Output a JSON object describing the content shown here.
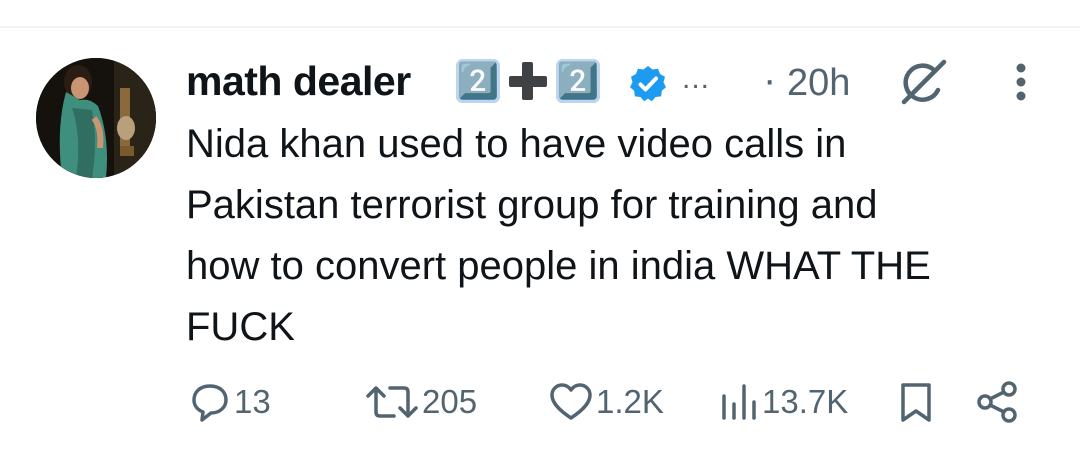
{
  "tweet": {
    "author": {
      "display_name": "math dealer",
      "name_emoji": [
        "2️⃣",
        "➕",
        "2️⃣"
      ],
      "verified": true,
      "avatar_icon": "profile-photo"
    },
    "truncation": "...",
    "time_separator": "·",
    "timestamp": "20h",
    "text": "Nida khan used to have video calls in\nPakistan terrorist group for training and\nhow to convert people in india WHAT THE\nFUCK",
    "metrics": {
      "replies": "13",
      "reposts": "205",
      "likes": "1.2K",
      "views": "13.7K"
    }
  },
  "icons": {
    "verified": "verified-badge-icon",
    "grok": "grok-icon",
    "more": "more-options-icon",
    "reply": "reply-icon",
    "repost": "repost-icon",
    "like": "like-icon",
    "views": "views-icon",
    "bookmark": "bookmark-icon",
    "share": "share-icon"
  },
  "colors": {
    "text": "#0f1419",
    "secondary": "#536471",
    "verified": "#1d9bf0",
    "divider": "#eff3f4",
    "background": "#ffffff"
  }
}
